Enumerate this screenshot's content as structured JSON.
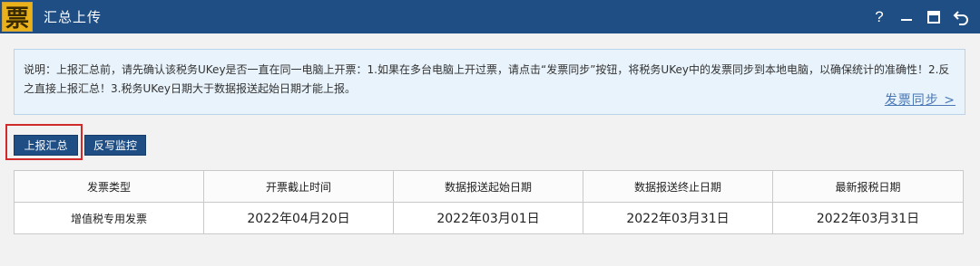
{
  "window": {
    "logo_char": "票",
    "title": "汇总上传",
    "controls": {
      "help": "?",
      "minimize_icon": "minimize-icon",
      "maximize_icon": "maximize-icon",
      "back_icon": "back-icon"
    }
  },
  "notice": {
    "text": "说明：上报汇总前，请先确认该税务UKey是否一直在同一电脑上开票：1.如果在多台电脑上开过票，请点击“发票同步”按钮，将税务UKey中的发票同步到本地电脑，以确保统计的准确性！2.反之直接上报汇总！3.税务UKey日期大于数据报送起始日期才能上报。",
    "sync_link": "发票同步 >"
  },
  "actions": {
    "report_summary": "上报汇总",
    "reverse_monitor": "反写监控"
  },
  "table": {
    "headers": [
      "发票类型",
      "开票截止时间",
      "数据报送起始日期",
      "数据报送终止日期",
      "最新报税日期"
    ],
    "rows": [
      [
        "增值税专用发票",
        "2022年04月20日",
        "2022年03月01日",
        "2022年03月31日",
        "2022年03月31日"
      ]
    ]
  },
  "colors": {
    "titlebar": "#1f4e84",
    "button": "#1f4e84",
    "highlight": "#d12a2a",
    "notice_bg": "#e8f3fb",
    "link": "#4a78b5"
  }
}
